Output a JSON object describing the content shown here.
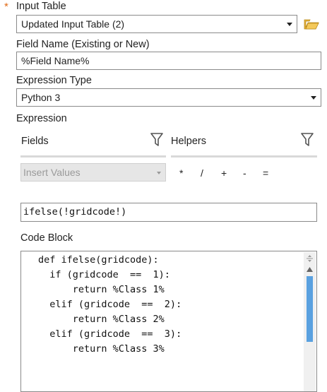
{
  "input_table": {
    "label": "Input Table",
    "required_marker": "*",
    "value": "Updated Input Table (2)"
  },
  "field_name": {
    "label": "Field Name (Existing or New)",
    "value": "%Field Name%"
  },
  "expression_type": {
    "label": "Expression Type",
    "value": "Python 3"
  },
  "expression": {
    "label": "Expression",
    "tabs": {
      "fields": "Fields",
      "helpers": "Helpers"
    },
    "insert_values": "Insert Values",
    "operators": [
      "*",
      "/",
      "+",
      "-",
      "="
    ],
    "value": "ifelse(!gridcode!)"
  },
  "code_block": {
    "label": "Code Block",
    "lines": [
      "def ifelse(gridcode):",
      "  if (gridcode  ==  1):",
      "      return %Class 1%",
      "  elif (gridcode  ==  2):",
      "      return %Class 2%",
      "  elif (gridcode  ==  3):",
      "      return %Class 3%"
    ]
  },
  "icons": {
    "folder": "folder-open-icon",
    "filter": "funnel-filter-icon",
    "dropdown": "chevron-down-icon"
  },
  "colors": {
    "required": "#e06a16",
    "folder": "#e8b339",
    "scroll_thumb": "#5aa1e0"
  }
}
